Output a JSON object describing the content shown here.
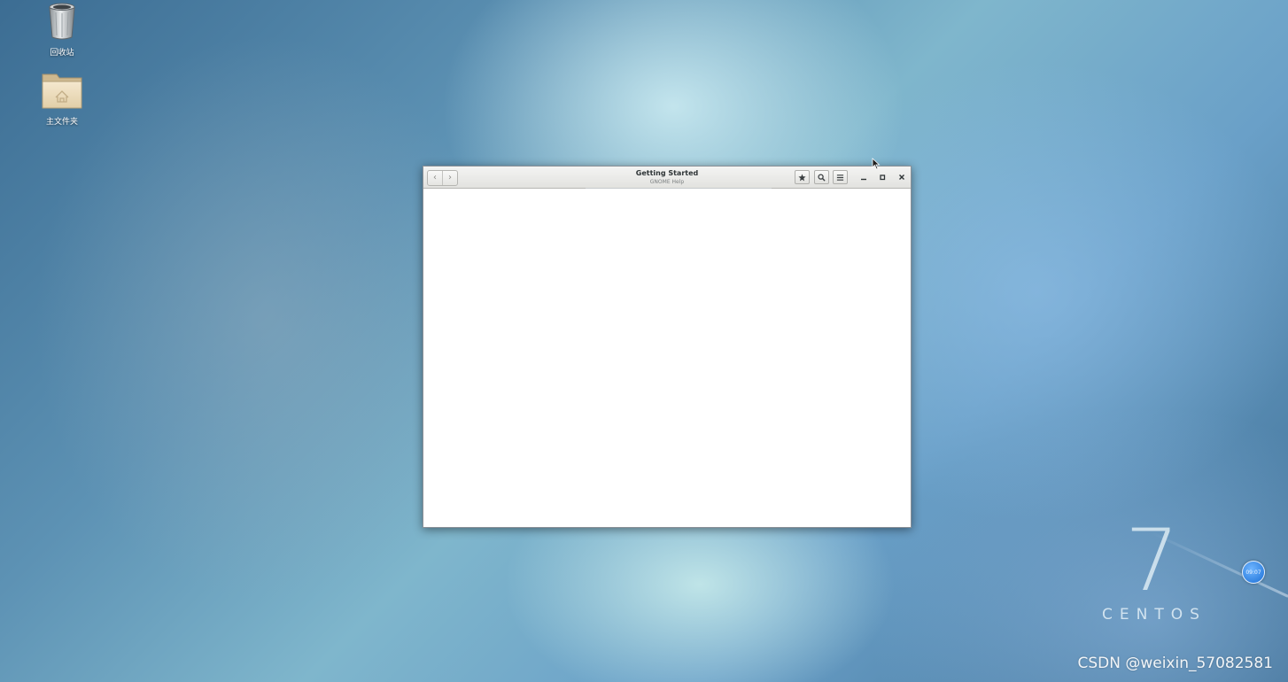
{
  "desktop": {
    "icons": [
      {
        "label": "回收站",
        "icon": "trash-icon"
      },
      {
        "label": "主文件夹",
        "icon": "home-folder-icon"
      }
    ],
    "watermark_number": "7",
    "watermark_word": "CENTOS",
    "clock_badge": "09:07",
    "csdn_watermark": "CSDN @weixin_57082581"
  },
  "window": {
    "title": "Getting Started",
    "subtitle": "GNOME Help",
    "nav": {
      "back_glyph": "‹",
      "forward_glyph": "›"
    },
    "toolbar": [
      {
        "icon": "bookmark-star-icon"
      },
      {
        "icon": "search-icon"
      },
      {
        "icon": "menu-icon"
      }
    ],
    "controls": [
      {
        "icon": "minimize-icon"
      },
      {
        "icon": "maximize-icon"
      },
      {
        "icon": "close-icon"
      }
    ]
  },
  "colors": {
    "desktop_base": "#5d92b4",
    "window_bg": "#ffffff",
    "titlebar": "#e8e8e6",
    "clock_badge": "#1a6fd6"
  }
}
